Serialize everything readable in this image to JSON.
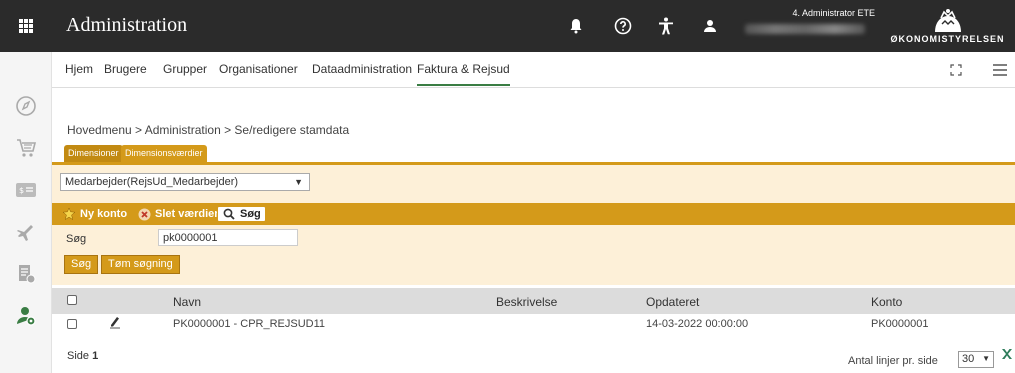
{
  "header": {
    "title": "Administration",
    "user_role": "4. Administrator ETE",
    "logo_text": "ØKONOMISTYRELSEN"
  },
  "navbar": {
    "tabs": [
      "Hjem",
      "Brugere",
      "Grupper",
      "Organisationer",
      "Dataadministration",
      "Faktura & Rejsud"
    ],
    "active_tab": "Faktura & Rejsud"
  },
  "breadcrumb": "Hovedmenu  >  Administration  >  Se/redigere stamdata",
  "subtabs": [
    "Dimensioner",
    "Dimensionsværdier"
  ],
  "dimension_select": {
    "value": "Medarbejder(RejsUd_Medarbejder)"
  },
  "toolbar": {
    "new_label": "Ny konto",
    "delete_label": "Slet værdier",
    "search_label": "Søg"
  },
  "search_form": {
    "label": "Søg",
    "value": "pk0000001",
    "search_button": "Søg",
    "clear_button": "Tøm søgning"
  },
  "table": {
    "columns": [
      "Navn",
      "Beskrivelse",
      "Opdateret",
      "Konto"
    ],
    "rows": [
      {
        "navn": "PK0000001 - CPR_REJSUD11",
        "beskrivelse": "",
        "opdateret": "14-03-2022 00:00:00",
        "konto": "PK0000001"
      }
    ]
  },
  "pagination": {
    "page_label": "Side",
    "page_number": "1",
    "per_page_label": "Antal linjer pr. side",
    "per_page_value": "30"
  },
  "colors": {
    "topbar": "#2b2b2b",
    "accent": "#d49a1a",
    "panel": "#fdf0d8",
    "active_tab_underline": "#3a7d44"
  }
}
